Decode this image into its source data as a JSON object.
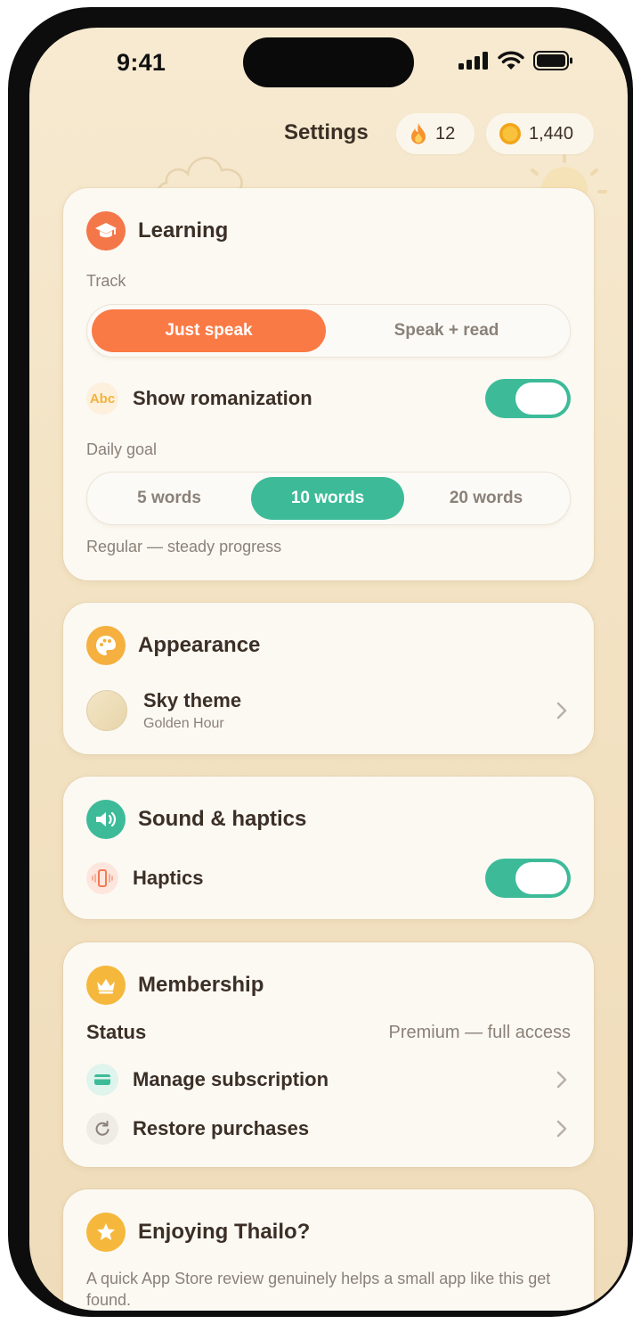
{
  "status_bar": {
    "time": "9:41"
  },
  "header": {
    "title": "Settings",
    "streak": {
      "icon": "flame-icon",
      "value": "12"
    },
    "coins": {
      "icon": "coin-icon",
      "value": "1,440"
    }
  },
  "learning": {
    "title": "Learning",
    "icon": "graduation-cap-icon",
    "track_label": "Track",
    "track_options": [
      "Just speak",
      "Speak + read"
    ],
    "track_selected": "Just speak",
    "romanization": {
      "icon_text": "Abc",
      "label": "Show romanization",
      "enabled": true
    },
    "daily_goal_label": "Daily goal",
    "goal_options": [
      "5 words",
      "10 words",
      "20 words"
    ],
    "goal_selected": "10 words",
    "goal_note": "Regular — steady progress"
  },
  "appearance": {
    "title": "Appearance",
    "icon": "palette-icon",
    "sky_theme": {
      "label": "Sky theme",
      "value": "Golden Hour"
    }
  },
  "sound": {
    "title": "Sound & haptics",
    "icon": "speaker-icon",
    "haptics": {
      "label": "Haptics",
      "icon": "phone-vibrate-icon",
      "enabled": true
    }
  },
  "membership": {
    "title": "Membership",
    "icon": "crown-icon",
    "status_label": "Status",
    "status_value": "Premium — full access",
    "manage": {
      "label": "Manage subscription",
      "icon": "credit-card-icon"
    },
    "restore": {
      "label": "Restore purchases",
      "icon": "refresh-icon"
    }
  },
  "review": {
    "title": "Enjoying Thailo?",
    "icon": "star-icon",
    "text": "A quick App Store review genuinely helps a small app like this get found."
  },
  "colors": {
    "accent_orange": "#fa7a45",
    "accent_teal": "#3dbb99",
    "accent_yellow": "#f5b83d"
  }
}
